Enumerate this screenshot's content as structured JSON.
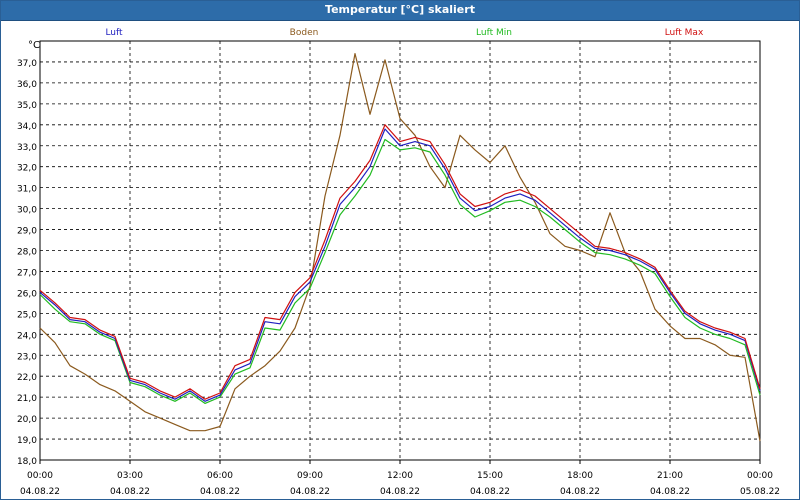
{
  "window": {
    "title": "Temperatur [°C] skaliert"
  },
  "chart_data": {
    "type": "line",
    "title": "Temperatur [°C] skaliert",
    "unit": "°C",
    "ylim": [
      18.0,
      38.0
    ],
    "y_ticks": [
      "18,0",
      "19,0",
      "20,0",
      "21,0",
      "22,0",
      "23,0",
      "24,0",
      "25,0",
      "26,0",
      "27,0",
      "28,0",
      "29,0",
      "30,0",
      "31,0",
      "32,0",
      "33,0",
      "34,0",
      "35,0",
      "36,0",
      "37,0"
    ],
    "x_range_hours": [
      0,
      24
    ],
    "x_ticks": [
      {
        "time": "00:00",
        "date": "04.08.22"
      },
      {
        "time": "03:00",
        "date": "04.08.22"
      },
      {
        "time": "06:00",
        "date": "04.08.22"
      },
      {
        "time": "09:00",
        "date": "04.08.22"
      },
      {
        "time": "12:00",
        "date": "04.08.22"
      },
      {
        "time": "15:00",
        "date": "04.08.22"
      },
      {
        "time": "18:00",
        "date": "04.08.22"
      },
      {
        "time": "21:00",
        "date": "04.08.22"
      },
      {
        "time": "00:00",
        "date": "05.08.22"
      }
    ],
    "grid": true,
    "legend_placement": "top",
    "x_hours": [
      0,
      0.5,
      1,
      1.5,
      2,
      2.5,
      3,
      3.5,
      4,
      4.5,
      5,
      5.5,
      6,
      6.5,
      7,
      7.5,
      8,
      8.5,
      9,
      9.5,
      10,
      10.5,
      11,
      11.5,
      12,
      12.5,
      13,
      13.5,
      14,
      14.5,
      15,
      15.5,
      16,
      16.5,
      17,
      17.5,
      18,
      18.5,
      19,
      19.5,
      20,
      20.5,
      21,
      21.5,
      22,
      22.5,
      23,
      23.5,
      24
    ],
    "series": [
      {
        "name": "Luft",
        "color": "#2020c0",
        "values": [
          26.0,
          25.4,
          24.7,
          24.6,
          24.1,
          23.8,
          21.8,
          21.6,
          21.2,
          20.9,
          21.3,
          20.8,
          21.1,
          22.3,
          22.6,
          24.6,
          24.5,
          25.8,
          26.5,
          28.2,
          30.2,
          31.0,
          32.0,
          33.8,
          33.0,
          33.2,
          33.0,
          31.9,
          30.5,
          29.9,
          30.1,
          30.5,
          30.7,
          30.4,
          29.8,
          29.2,
          28.6,
          28.1,
          28.0,
          27.8,
          27.5,
          27.1,
          26.0,
          25.0,
          24.5,
          24.2,
          24.0,
          23.7,
          21.3
        ]
      },
      {
        "name": "Boden",
        "color": "#8b5a1e",
        "values": [
          24.3,
          23.6,
          22.5,
          22.1,
          21.6,
          21.3,
          20.8,
          20.3,
          20.0,
          19.7,
          19.4,
          19.4,
          19.6,
          21.4,
          22.0,
          22.5,
          23.2,
          24.3,
          26.3,
          30.6,
          33.5,
          37.4,
          34.5,
          37.1,
          34.3,
          33.5,
          32.0,
          31.0,
          33.5,
          32.8,
          32.2,
          33.0,
          31.5,
          30.3,
          28.8,
          28.2,
          28.0,
          27.7,
          29.8,
          27.9,
          27.0,
          25.2,
          24.4,
          23.8,
          23.8,
          23.5,
          23.0,
          22.9,
          18.9
        ]
      },
      {
        "name": "Luft Min",
        "color": "#22bb22",
        "values": [
          25.9,
          25.2,
          24.6,
          24.5,
          24.0,
          23.7,
          21.7,
          21.5,
          21.1,
          20.8,
          21.2,
          20.7,
          21.0,
          22.1,
          22.4,
          24.3,
          24.2,
          25.5,
          26.2,
          27.9,
          29.7,
          30.6,
          31.6,
          33.3,
          32.8,
          32.9,
          32.7,
          31.6,
          30.2,
          29.6,
          29.9,
          30.3,
          30.4,
          30.1,
          29.6,
          29.0,
          28.4,
          27.9,
          27.8,
          27.6,
          27.3,
          26.9,
          25.8,
          24.8,
          24.3,
          24.0,
          23.8,
          23.5,
          21.1
        ]
      },
      {
        "name": "Luft Max",
        "color": "#d01010",
        "values": [
          26.1,
          25.5,
          24.8,
          24.7,
          24.2,
          23.9,
          21.9,
          21.7,
          21.3,
          21.0,
          21.4,
          20.9,
          21.2,
          22.5,
          22.8,
          24.8,
          24.7,
          26.0,
          26.7,
          28.5,
          30.5,
          31.3,
          32.3,
          34.0,
          33.2,
          33.4,
          33.2,
          32.1,
          30.7,
          30.1,
          30.3,
          30.7,
          30.9,
          30.6,
          30.0,
          29.4,
          28.8,
          28.2,
          28.1,
          27.9,
          27.6,
          27.2,
          26.1,
          25.1,
          24.6,
          24.3,
          24.1,
          23.8,
          21.4
        ]
      }
    ]
  }
}
